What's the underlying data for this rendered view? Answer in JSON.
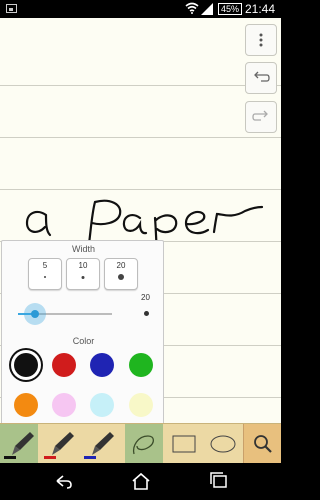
{
  "status_bar": {
    "battery": "45%",
    "time": "21:44",
    "icons": [
      "image-notification-icon",
      "wifi-icon",
      "signal-icon",
      "battery-icon"
    ]
  },
  "canvas": {
    "handwritten_text": "a Paper"
  },
  "side_buttons": [
    {
      "name": "more-options",
      "icon": "more-vert-icon"
    },
    {
      "name": "undo",
      "icon": "undo-icon"
    },
    {
      "name": "redo",
      "icon": "redo-icon"
    }
  ],
  "pen_popup": {
    "width_label": "Width",
    "width_presets": [
      "5",
      "10",
      "20"
    ],
    "slider_max_label": "20",
    "slider_level": 0.18,
    "color_label": "Color",
    "colors": [
      "#111111",
      "#d01c1c",
      "#1f24b3",
      "#1fb51f",
      "#f38a11",
      "#f6c6f2",
      "#c6f0f8",
      "#f8f8c8"
    ],
    "selected_color": "#111111"
  },
  "toolbar": {
    "tools": [
      {
        "name": "pen-tool-black",
        "icon": "pen-icon",
        "active": true
      },
      {
        "name": "pen-tool-red",
        "icon": "pen-icon"
      },
      {
        "name": "pen-tool-blue",
        "icon": "pen-icon"
      },
      {
        "name": "lasso-tool",
        "icon": "lasso-icon",
        "active": true
      },
      {
        "name": "rectangle-tool",
        "icon": "rectangle-icon"
      },
      {
        "name": "ellipse-tool",
        "icon": "ellipse-icon"
      },
      {
        "name": "search-tool",
        "icon": "search-icon"
      }
    ]
  },
  "nav_bar": [
    "back-icon",
    "home-icon",
    "recent-apps-icon"
  ]
}
